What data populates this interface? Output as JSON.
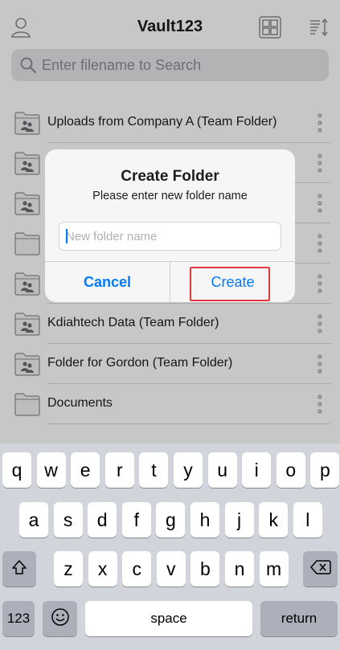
{
  "header": {
    "title": "Vault123",
    "profile_icon": "person-icon",
    "view_icon": "grid-view-icon",
    "sort_icon": "sort-icon"
  },
  "search": {
    "placeholder": "Enter filename to Search",
    "icon": "search-icon"
  },
  "files": [
    {
      "name": "Uploads from Company A (Team Folder)",
      "type": "team-folder"
    },
    {
      "name": "",
      "type": "team-folder"
    },
    {
      "name": "",
      "type": "team-folder"
    },
    {
      "name": "",
      "type": "folder"
    },
    {
      "name": "",
      "type": "team-folder"
    },
    {
      "name": "Kdiahtech Data (Team Folder)",
      "type": "team-folder"
    },
    {
      "name": "Folder for Gordon (Team Folder)",
      "type": "team-folder"
    },
    {
      "name": "Documents",
      "type": "folder"
    }
  ],
  "dialog": {
    "title": "Create Folder",
    "message": "Please enter new folder name",
    "input_placeholder": "New folder name",
    "input_value": "",
    "cancel_label": "Cancel",
    "create_label": "Create"
  },
  "keyboard": {
    "row1": [
      "q",
      "w",
      "e",
      "r",
      "t",
      "y",
      "u",
      "i",
      "o",
      "p"
    ],
    "row2": [
      "a",
      "s",
      "d",
      "f",
      "g",
      "h",
      "j",
      "k",
      "l"
    ],
    "row3": [
      "z",
      "x",
      "c",
      "v",
      "b",
      "n",
      "m"
    ],
    "shift_icon": "shift-icon",
    "delete_icon": "backspace-icon",
    "numbers_label": "123",
    "emoji_icon": "emoji-icon",
    "space_label": "space",
    "return_label": "return"
  },
  "colors": {
    "accent": "#007aff",
    "highlight": "#e0393e",
    "keyboard_bg": "#d1d4db"
  }
}
